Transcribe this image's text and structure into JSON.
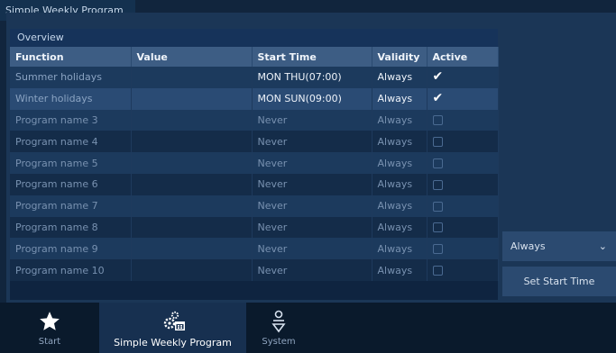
{
  "window_title": "Simple Weekly Program",
  "overview_label": "Overview",
  "columns": [
    "Function",
    "Value",
    "Start Time",
    "Validity",
    "Active"
  ],
  "rows": [
    {
      "function": "Summer holidays",
      "value": "",
      "start": "MON THU(07:00)",
      "validity": "Always",
      "active": true
    },
    {
      "function": "Winter holidays",
      "value": "",
      "start": "MON SUN(09:00)",
      "validity": "Always",
      "active": true
    },
    {
      "function": "Program name 3",
      "value": "",
      "start": "Never",
      "validity": "Always",
      "active": false
    },
    {
      "function": "Program name 4",
      "value": "",
      "start": "Never",
      "validity": "Always",
      "active": false
    },
    {
      "function": "Program name 5",
      "value": "",
      "start": "Never",
      "validity": "Always",
      "active": false
    },
    {
      "function": "Program name 6",
      "value": "",
      "start": "Never",
      "validity": "Always",
      "active": false
    },
    {
      "function": "Program name 7",
      "value": "",
      "start": "Never",
      "validity": "Always",
      "active": false
    },
    {
      "function": "Program name 8",
      "value": "",
      "start": "Never",
      "validity": "Always",
      "active": false
    },
    {
      "function": "Program name 9",
      "value": "",
      "start": "Never",
      "validity": "Always",
      "active": false
    },
    {
      "function": "Program name 10",
      "value": "",
      "start": "Never",
      "validity": "Always",
      "active": false
    }
  ],
  "right_panel": {
    "validity_select": "Always",
    "set_start_time_label": "Set Start Time"
  },
  "nav": [
    {
      "label": "Start",
      "icon": "star-icon",
      "selected": false
    },
    {
      "label": "Simple Weekly Program",
      "icon": "gears-calendar-icon",
      "selected": true
    },
    {
      "label": "System",
      "icon": "system-icon",
      "selected": false
    }
  ]
}
